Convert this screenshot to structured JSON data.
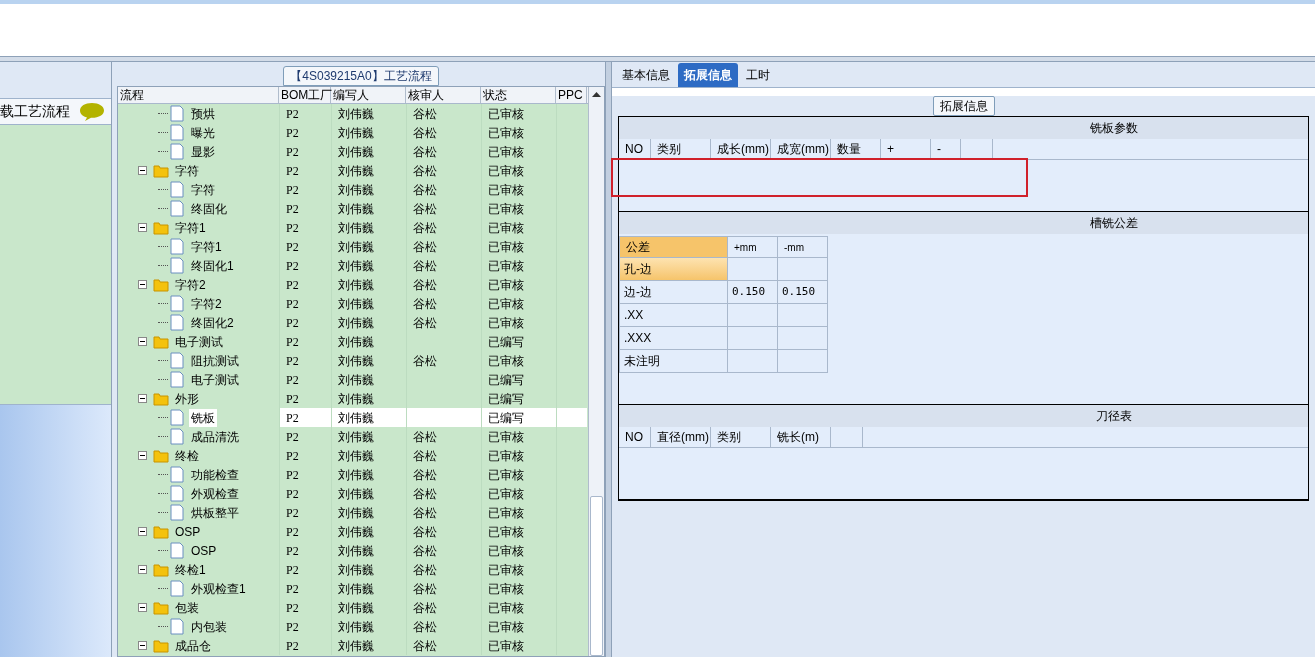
{
  "left_panel": {
    "title": "载工艺流程"
  },
  "process_panel": {
    "title": "【4S039215A0】工艺流程",
    "columns": [
      "流程",
      "BOM工厂",
      "编写人",
      "核审人",
      "状态",
      "PPC"
    ],
    "tree": [
      {
        "kind": "scrolled_parent",
        "children": [
          {
            "kind": "file",
            "name": "预烘",
            "bom": "P2",
            "writer": "刘伟巍",
            "reviewer": "谷松",
            "status": "已审核",
            "selected": false
          },
          {
            "kind": "file",
            "name": "曝光",
            "bom": "P2",
            "writer": "刘伟巍",
            "reviewer": "谷松",
            "status": "已审核",
            "selected": false
          },
          {
            "kind": "file",
            "name": "显影",
            "bom": "P2",
            "writer": "刘伟巍",
            "reviewer": "谷松",
            "status": "已审核",
            "selected": false
          }
        ]
      },
      {
        "kind": "folder",
        "name": "字符",
        "bom": "P2",
        "writer": "刘伟巍",
        "reviewer": "谷松",
        "status": "已审核",
        "selected": false,
        "children": [
          {
            "kind": "file",
            "name": "字符",
            "bom": "P2",
            "writer": "刘伟巍",
            "reviewer": "谷松",
            "status": "已审核",
            "selected": false
          },
          {
            "kind": "file",
            "name": "终固化",
            "bom": "P2",
            "writer": "刘伟巍",
            "reviewer": "谷松",
            "status": "已审核",
            "selected": false
          }
        ]
      },
      {
        "kind": "folder",
        "name": "字符1",
        "bom": "P2",
        "writer": "刘伟巍",
        "reviewer": "谷松",
        "status": "已审核",
        "selected": false,
        "children": [
          {
            "kind": "file",
            "name": "字符1",
            "bom": "P2",
            "writer": "刘伟巍",
            "reviewer": "谷松",
            "status": "已审核",
            "selected": false
          },
          {
            "kind": "file",
            "name": "终固化1",
            "bom": "P2",
            "writer": "刘伟巍",
            "reviewer": "谷松",
            "status": "已审核",
            "selected": false
          }
        ]
      },
      {
        "kind": "folder",
        "name": "字符2",
        "bom": "P2",
        "writer": "刘伟巍",
        "reviewer": "谷松",
        "status": "已审核",
        "selected": false,
        "children": [
          {
            "kind": "file",
            "name": "字符2",
            "bom": "P2",
            "writer": "刘伟巍",
            "reviewer": "谷松",
            "status": "已审核",
            "selected": false
          },
          {
            "kind": "file",
            "name": "终固化2",
            "bom": "P2",
            "writer": "刘伟巍",
            "reviewer": "谷松",
            "status": "已审核",
            "selected": false
          }
        ]
      },
      {
        "kind": "folder",
        "name": "电子测试",
        "bom": "P2",
        "writer": "刘伟巍",
        "status": "已编写",
        "selected": false,
        "children": [
          {
            "kind": "file",
            "name": "阻抗测试",
            "bom": "P2",
            "writer": "刘伟巍",
            "reviewer": "谷松",
            "status": "已审核",
            "selected": false
          },
          {
            "kind": "file",
            "name": "电子测试",
            "bom": "P2",
            "writer": "刘伟巍",
            "status": "已编写",
            "selected": false
          }
        ]
      },
      {
        "kind": "folder",
        "name": "外形",
        "bom": "P2",
        "writer": "刘伟巍",
        "status": "已编写",
        "selected": false,
        "children": [
          {
            "kind": "file",
            "name": "铣板",
            "bom": "P2",
            "writer": "刘伟巍",
            "status": "已编写",
            "selected": true
          },
          {
            "kind": "file",
            "name": "成品清洗",
            "bom": "P2",
            "writer": "刘伟巍",
            "reviewer": "谷松",
            "status": "已审核",
            "selected": false
          }
        ]
      },
      {
        "kind": "folder",
        "name": "终检",
        "bom": "P2",
        "writer": "刘伟巍",
        "reviewer": "谷松",
        "status": "已审核",
        "selected": false,
        "children": [
          {
            "kind": "file",
            "name": "功能检查",
            "bom": "P2",
            "writer": "刘伟巍",
            "reviewer": "谷松",
            "status": "已审核",
            "selected": false
          },
          {
            "kind": "file",
            "name": "外观检查",
            "bom": "P2",
            "writer": "刘伟巍",
            "reviewer": "谷松",
            "status": "已审核",
            "selected": false
          },
          {
            "kind": "file",
            "name": "烘板整平",
            "bom": "P2",
            "writer": "刘伟巍",
            "reviewer": "谷松",
            "status": "已审核",
            "selected": false
          }
        ]
      },
      {
        "kind": "folder",
        "name": "OSP",
        "bom": "P2",
        "writer": "刘伟巍",
        "reviewer": "谷松",
        "status": "已审核",
        "selected": false,
        "children": [
          {
            "kind": "file",
            "name": "OSP",
            "bom": "P2",
            "writer": "刘伟巍",
            "reviewer": "谷松",
            "status": "已审核",
            "selected": false
          }
        ]
      },
      {
        "kind": "folder",
        "name": "终检1",
        "bom": "P2",
        "writer": "刘伟巍",
        "reviewer": "谷松",
        "status": "已审核",
        "selected": false,
        "children": [
          {
            "kind": "file",
            "name": "外观检查1",
            "bom": "P2",
            "writer": "刘伟巍",
            "reviewer": "谷松",
            "status": "已审核",
            "selected": false
          }
        ]
      },
      {
        "kind": "folder",
        "name": "包装",
        "bom": "P2",
        "writer": "刘伟巍",
        "reviewer": "谷松",
        "status": "已审核",
        "selected": false,
        "children": [
          {
            "kind": "file",
            "name": "内包装",
            "bom": "P2",
            "writer": "刘伟巍",
            "reviewer": "谷松",
            "status": "已审核",
            "selected": false
          }
        ]
      },
      {
        "kind": "folder",
        "name": "成品仓",
        "bom": "P2",
        "writer": "刘伟巍",
        "reviewer": "谷松",
        "status": "已审核",
        "selected": false
      }
    ]
  },
  "detail_panel": {
    "tabs": [
      {
        "label": "基本信息",
        "selected": false
      },
      {
        "label": "拓展信息",
        "selected": true
      },
      {
        "label": "工时",
        "selected": false
      }
    ],
    "group_title": "拓展信息",
    "sections": [
      {
        "kind": "grid",
        "title": "铣板参数",
        "highlighted": true,
        "columns": [
          "NO",
          "类别",
          "成长(mm)",
          "成宽(mm)",
          "数量",
          "+",
          "-"
        ]
      },
      {
        "kind": "tolerance",
        "title": "槽铣公差",
        "columns": [
          "公差",
          "+mm",
          "-mm"
        ],
        "rows": [
          {
            "label": "孔-边",
            "selected": true
          },
          {
            "label": "边-边",
            "plus": "0.150",
            "minus": "0.150",
            "selected": false
          },
          {
            "label": ".XX",
            "selected": false
          },
          {
            "label": ".XXX",
            "selected": false
          },
          {
            "label": "未注明",
            "selected": false
          }
        ]
      },
      {
        "kind": "grid",
        "title": "刀径表",
        "columns": [
          "NO",
          "直径(mm)",
          "类别",
          "铣长(m)"
        ]
      }
    ]
  }
}
